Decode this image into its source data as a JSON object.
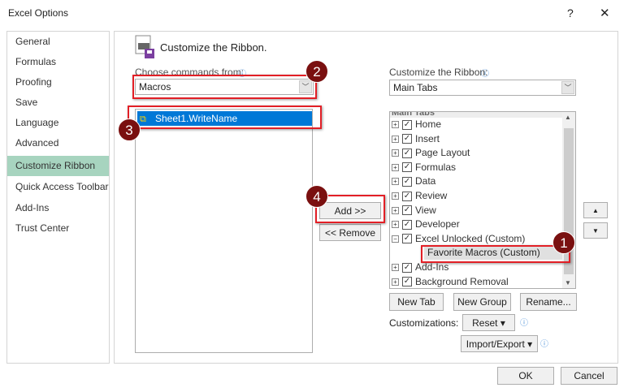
{
  "window": {
    "title": "Excel Options",
    "help": "?",
    "close": "✕"
  },
  "sidebar": {
    "items": [
      {
        "label": "General"
      },
      {
        "label": "Formulas"
      },
      {
        "label": "Proofing"
      },
      {
        "label": "Save"
      },
      {
        "label": "Language"
      },
      {
        "label": "Advanced"
      },
      {
        "label": "Customize Ribbon",
        "selected": true
      },
      {
        "label": "Quick Access Toolbar"
      },
      {
        "label": "Add-Ins"
      },
      {
        "label": "Trust Center"
      }
    ]
  },
  "main": {
    "heading": "Customize the Ribbon.",
    "left": {
      "label": "Choose commands from:",
      "select_value": "Macros",
      "items": [
        "Sheet1.WriteName"
      ]
    },
    "right": {
      "label": "Customize the Ribbon:",
      "select_value": "Main Tabs",
      "tree_header": "Main Tabs",
      "tree": [
        {
          "label": "Home",
          "expand": "+"
        },
        {
          "label": "Insert",
          "expand": "+"
        },
        {
          "label": "Page Layout",
          "expand": "+"
        },
        {
          "label": "Formulas",
          "expand": "+"
        },
        {
          "label": "Data",
          "expand": "+"
        },
        {
          "label": "Review",
          "expand": "+"
        },
        {
          "label": "View",
          "expand": "+"
        },
        {
          "label": "Developer",
          "expand": "+"
        },
        {
          "label": "Excel Unlocked (Custom)",
          "expand": "−"
        },
        {
          "label": "Favorite Macros (Custom)",
          "child": true
        },
        {
          "label": "Add-Ins",
          "expand": "+"
        },
        {
          "label": "Background Removal",
          "expand": "+"
        }
      ]
    },
    "add_label": "Add >>",
    "remove_label": "<< Remove",
    "new_tab": "New Tab",
    "new_group": "New Group",
    "rename": "Rename...",
    "customizations_label": "Customizations:",
    "reset": "Reset ▾",
    "import_export": "Import/Export ▾",
    "up": "▲",
    "down": "▼"
  },
  "callouts": [
    "1",
    "2",
    "3",
    "4"
  ],
  "accent": "#e21f26",
  "footer": {
    "ok": "OK",
    "cancel": "Cancel"
  }
}
